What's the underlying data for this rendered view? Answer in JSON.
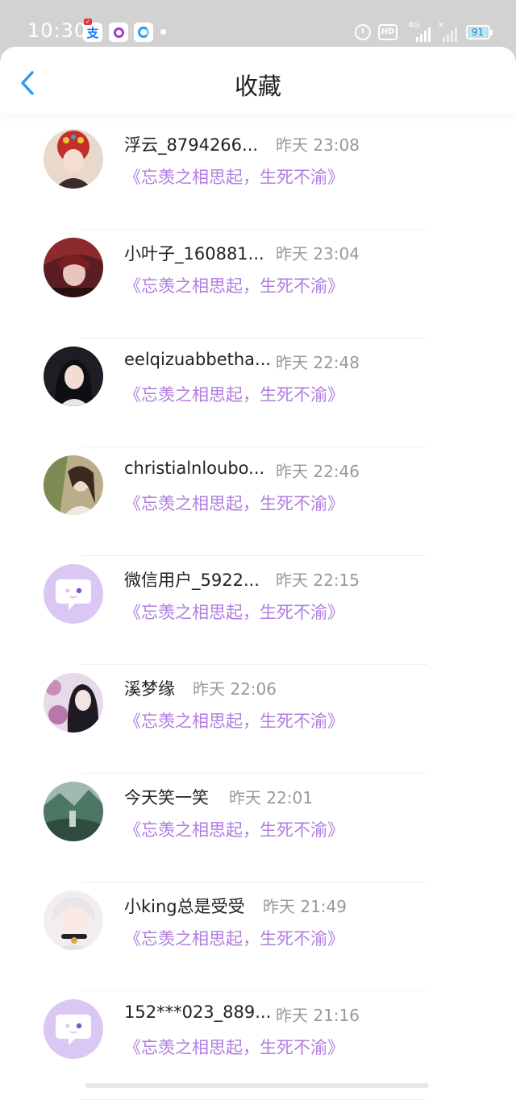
{
  "status_bar": {
    "time": "10:30",
    "signal_label": "4G",
    "battery": "91",
    "icons": [
      "alipay-icon",
      "app-icon",
      "browser-icon",
      "alarm-icon",
      "hd-icon",
      "signal-icon",
      "battery-icon"
    ]
  },
  "header": {
    "title": "收藏",
    "back_icon": "chevron-left-icon"
  },
  "colors": {
    "accent": "#2f9bf0",
    "work_title": "#b07de0",
    "default_avatar": "#dac7f3"
  },
  "items": [
    {
      "name": "浮云_8794266...",
      "time": "昨天 23:08",
      "work": "《忘羡之相思起，生死不渝》",
      "avatar": "photo"
    },
    {
      "name": "小叶子_160881...",
      "time": "昨天 23:04",
      "work": "《忘羡之相思起，生死不渝》",
      "avatar": "photo"
    },
    {
      "name": "eelqizuabbetha...",
      "time": "昨天 22:48",
      "work": "《忘羡之相思起，生死不渝》",
      "avatar": "photo"
    },
    {
      "name": "christialnloubo...",
      "time": "昨天 22:46",
      "work": "《忘羡之相思起，生死不渝》",
      "avatar": "photo"
    },
    {
      "name": "微信用户_5922...",
      "time": "昨天 22:15",
      "work": "《忘羡之相思起，生死不渝》",
      "avatar": "default"
    },
    {
      "name": "溪梦缘",
      "time": "昨天 22:06",
      "work": "《忘羡之相思起，生死不渝》",
      "avatar": "photo"
    },
    {
      "name": "今天笑一笑",
      "time": "昨天 22:01",
      "work": "《忘羡之相思起，生死不渝》",
      "avatar": "photo"
    },
    {
      "name": "小king总是受受",
      "time": "昨天 21:49",
      "work": "《忘羡之相思起，生死不渝》",
      "avatar": "photo"
    },
    {
      "name": "152***023_889...",
      "time": "昨天 21:16",
      "work": "《忘羡之相思起，生死不渝》",
      "avatar": "default"
    }
  ]
}
